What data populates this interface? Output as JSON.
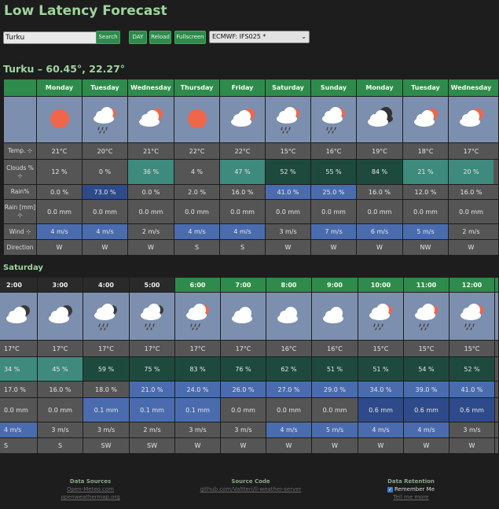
{
  "title": "Low Latency Forecast",
  "controls": {
    "search_value": "Turku",
    "search_label": "Search",
    "day_label": "DAY",
    "reload_label": "Reload",
    "fullscreen_label": "Fullscreen",
    "model_value": "ECMWF: IFS025 *"
  },
  "location": "Turku – 60.45°, 22.27°",
  "daily": {
    "row_labels": [
      "Temp. ⊹",
      "Clouds % ⊹",
      "Rain%",
      "Rain [mm] ⊹",
      "Wind ⊹",
      "Direction"
    ],
    "columns": [
      {
        "day": "Monday",
        "icon": "sun-icon",
        "temp": "21°C",
        "clouds": "12 %",
        "rainp": "0.0 %",
        "rain": "0.0 mm",
        "wind": "4 m/s",
        "dir": "W"
      },
      {
        "day": "Tuesday",
        "icon": "cloud-rain-sun-icon",
        "temp": "20°C",
        "clouds": "0 %",
        "rainp": "73.0 %",
        "rain": "0.0 mm",
        "wind": "4 m/s",
        "dir": "W"
      },
      {
        "day": "Wednesday",
        "icon": "cloud-sun-icon",
        "temp": "21°C",
        "clouds": "36 %",
        "rainp": "0.0 %",
        "rain": "0.0 mm",
        "wind": "2 m/s",
        "dir": "W"
      },
      {
        "day": "Thursday",
        "icon": "sun-icon",
        "temp": "22°C",
        "clouds": "4 %",
        "rainp": "2.0 %",
        "rain": "0.0 mm",
        "wind": "4 m/s",
        "dir": "S"
      },
      {
        "day": "Friday",
        "icon": "cloud-sun-icon",
        "temp": "22°C",
        "clouds": "47 %",
        "rainp": "16.0 %",
        "rain": "0.0 mm",
        "wind": "4 m/s",
        "dir": "S"
      },
      {
        "day": "Saturday",
        "icon": "cloud-rain-sun-icon",
        "temp": "15°C",
        "clouds": "52 %",
        "rainp": "41.0 %",
        "rain": "0.0 mm",
        "wind": "3 m/s",
        "dir": "W"
      },
      {
        "day": "Sunday",
        "icon": "cloud-rain-sun-icon",
        "temp": "16°C",
        "clouds": "55 %",
        "rainp": "25.0 %",
        "rain": "0.0 mm",
        "wind": "7 m/s",
        "dir": "W"
      },
      {
        "day": "Monday",
        "icon": "cloud-dark-icon",
        "temp": "19°C",
        "clouds": "84 %",
        "rainp": "16.0 %",
        "rain": "0.0 mm",
        "wind": "6 m/s",
        "dir": "W"
      },
      {
        "day": "Tuesday",
        "icon": "cloud-sun-icon",
        "temp": "18°C",
        "clouds": "21 %",
        "rainp": "12.0 %",
        "rain": "0.0 mm",
        "wind": "5 m/s",
        "dir": "NW"
      },
      {
        "day": "Wednesday",
        "icon": "cloud-sun-icon",
        "temp": "17°C",
        "clouds": "20 %",
        "rainp": "16.0 %",
        "rain": "0.0 mm",
        "wind": "2 m/s",
        "dir": "W"
      }
    ]
  },
  "hourly_title": "Saturday",
  "hourly": {
    "columns": [
      {
        "time": "2:00",
        "night": true,
        "icon": "cloud-moon-icon",
        "temp": "17°C",
        "clouds": "34 %",
        "rainp": "17.0 %",
        "rain": "0.0 mm",
        "wind": "4 m/s",
        "dir": "S"
      },
      {
        "time": "3:00",
        "night": true,
        "icon": "cloud-moon-icon",
        "temp": "17°C",
        "clouds": "45 %",
        "rainp": "16.0 %",
        "rain": "0.0 mm",
        "wind": "3 m/s",
        "dir": "S"
      },
      {
        "time": "4:00",
        "night": true,
        "icon": "cloud-rain-moon-icon",
        "temp": "17°C",
        "clouds": "59 %",
        "rainp": "18.0 %",
        "rain": "0.1 mm",
        "wind": "3 m/s",
        "dir": "SW"
      },
      {
        "time": "5:00",
        "night": true,
        "icon": "cloud-rain-moon-icon",
        "temp": "17°C",
        "clouds": "75 %",
        "rainp": "21.0 %",
        "rain": "0.1 mm",
        "wind": "2 m/s",
        "dir": "SW"
      },
      {
        "time": "6:00",
        "night": false,
        "icon": "cloud-rain-sun-icon",
        "temp": "17°C",
        "clouds": "83 %",
        "rainp": "24.0 %",
        "rain": "0.1 mm",
        "wind": "3 m/s",
        "dir": "W"
      },
      {
        "time": "7:00",
        "night": false,
        "icon": "cloud-icon",
        "temp": "17°C",
        "clouds": "76 %",
        "rainp": "26.0 %",
        "rain": "0.0 mm",
        "wind": "3 m/s",
        "dir": "W"
      },
      {
        "time": "8:00",
        "night": false,
        "icon": "cloud-icon",
        "temp": "16°C",
        "clouds": "62 %",
        "rainp": "27.0 %",
        "rain": "0.0 mm",
        "wind": "4 m/s",
        "dir": "W"
      },
      {
        "time": "9:00",
        "night": false,
        "icon": "cloud-icon",
        "temp": "16°C",
        "clouds": "51 %",
        "rainp": "29.0 %",
        "rain": "0.0 mm",
        "wind": "5 m/s",
        "dir": "W"
      },
      {
        "time": "10:00",
        "night": false,
        "icon": "cloud-rain-sun-icon",
        "temp": "15°C",
        "clouds": "51 %",
        "rainp": "34.0 %",
        "rain": "0.6 mm",
        "wind": "4 m/s",
        "dir": "W"
      },
      {
        "time": "11:00",
        "night": false,
        "icon": "cloud-rain-sun-icon",
        "temp": "15°C",
        "clouds": "54 %",
        "rainp": "39.0 %",
        "rain": "0.6 mm",
        "wind": "4 m/s",
        "dir": "W"
      },
      {
        "time": "12:00",
        "night": false,
        "icon": "cloud-rain-sun-icon",
        "temp": "15°C",
        "clouds": "52 %",
        "rainp": "41.0 %",
        "rain": "0.6 mm",
        "wind": "3 m/s",
        "dir": "W"
      }
    ]
  },
  "footer": {
    "sources_title": "Data Sources",
    "source1": "Open-Meteo.com",
    "source2": "openweathermap.org",
    "code_title": "Source Code",
    "code_link": "github.com/Valtteri/ll-weather-server",
    "retention_title": "Data Retention",
    "remember_label": "Remember Me",
    "tell_more": "Tell me more"
  },
  "colors": {
    "green_header": "#2e8b4c",
    "icon_bg": "#7d8fae",
    "cell_grey": "#555555",
    "teal": "#3e8a7c",
    "dark_teal": "#1e4a3e",
    "blue": "#4a6cae",
    "dark_blue": "#2e4a8a"
  }
}
